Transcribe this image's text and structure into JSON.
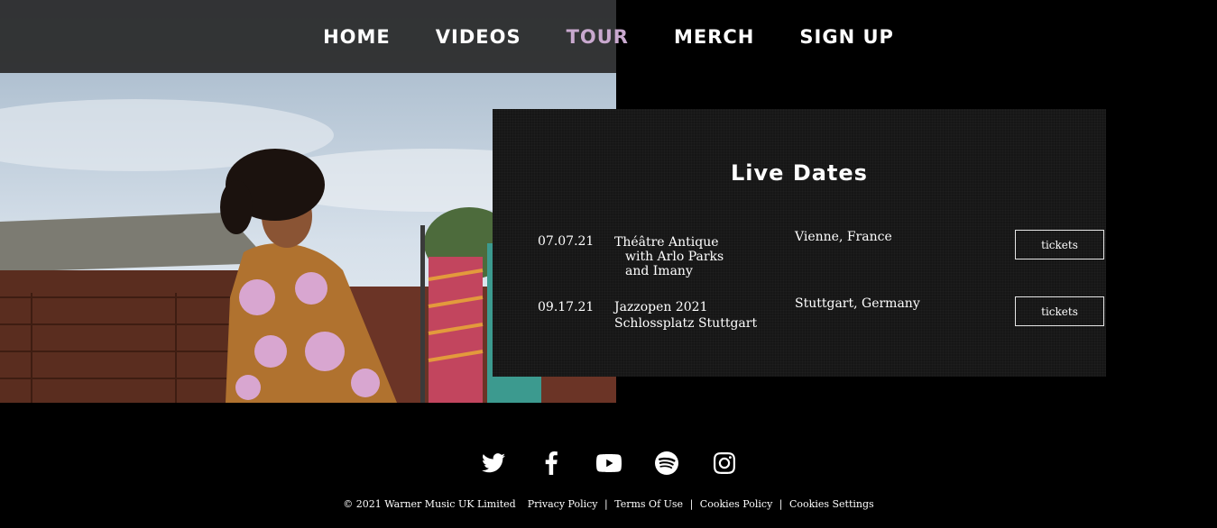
{
  "nav": {
    "items": [
      {
        "label": "HOME",
        "active": false
      },
      {
        "label": "VIDEOS",
        "active": false
      },
      {
        "label": "TOUR",
        "active": true
      },
      {
        "label": "MERCH",
        "active": false
      },
      {
        "label": "SIGN UP",
        "active": false
      }
    ],
    "active_color": "#c9a9cf"
  },
  "tour": {
    "title": "Live Dates",
    "events": [
      {
        "date": "07.07.21",
        "venue_lines": [
          "Théâtre Antique",
          "with Arlo Parks",
          "and Imany"
        ],
        "city": "Vienne, France",
        "button": "tickets"
      },
      {
        "date": "09.17.21",
        "venue_lines": [
          "Jazzopen 2021",
          "Schlossplatz Stuttgart"
        ],
        "city": "Stuttgart, Germany",
        "button": "tickets"
      }
    ]
  },
  "social": [
    "twitter-icon",
    "facebook-icon",
    "youtube-icon",
    "spotify-icon",
    "instagram-icon"
  ],
  "footer": {
    "copyright": "© 2021 Warner Music UK Limited",
    "links": [
      "Privacy Policy",
      "Terms Of Use",
      "Cookies Policy",
      "Cookies Settings"
    ],
    "separator": "|"
  }
}
